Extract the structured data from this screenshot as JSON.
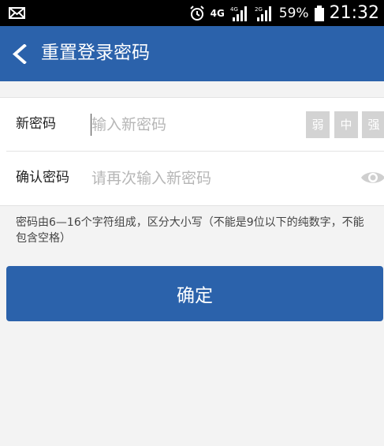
{
  "status_bar": {
    "network": "4G",
    "signal_1_label": "4G",
    "signal_2_label": "2G",
    "battery_percent": "59%",
    "time": "21:32",
    "icons": [
      "mail-icon",
      "alarm-icon",
      "signal-icon",
      "battery-icon"
    ]
  },
  "header": {
    "back_icon": "back-chevron-icon",
    "title": "重置登录密码"
  },
  "form": {
    "new_password": {
      "label": "新密码",
      "placeholder": "输入新密码",
      "value": "",
      "strength_labels": [
        "弱",
        "中",
        "强"
      ]
    },
    "confirm_password": {
      "label": "确认密码",
      "placeholder": "请再次输入新密码",
      "value": "",
      "visibility_icon": "eye-icon"
    }
  },
  "hint": "密码由6—16个字符组成，区分大小写（不能是9位以下的纯数字，不能包含空格）",
  "confirm_button": "确定",
  "colors": {
    "primary": "#2b62ab",
    "status_bar": "#000000",
    "background": "#f3f3f3",
    "strength_inactive": "#d3d3d3",
    "placeholder": "#b6b6b6"
  }
}
